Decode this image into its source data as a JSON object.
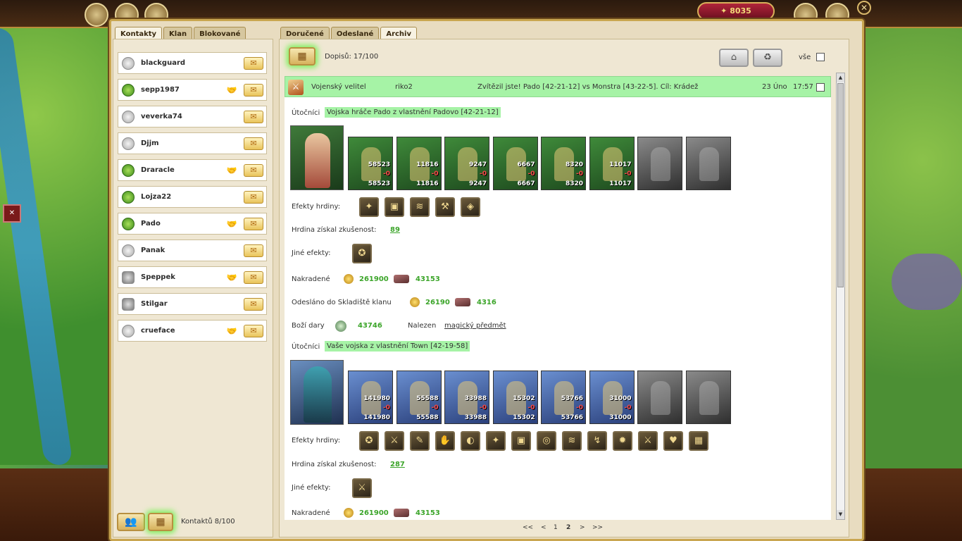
{
  "top": {
    "gold": "8035",
    "close_symbol": "✕"
  },
  "contacts_tabs": [
    "Kontakty",
    "Klan",
    "Blokované"
  ],
  "contacts": [
    {
      "name": "blackguard",
      "icon": "grey",
      "hands": false
    },
    {
      "name": "sepp1987",
      "icon": "green",
      "hands": true
    },
    {
      "name": "veverka74",
      "icon": "grey",
      "hands": false
    },
    {
      "name": "Djjm",
      "icon": "grey",
      "hands": false
    },
    {
      "name": "Draracle",
      "icon": "green",
      "hands": true
    },
    {
      "name": "Lojza22",
      "icon": "green",
      "hands": false
    },
    {
      "name": "Pado",
      "icon": "green",
      "hands": true
    },
    {
      "name": "Panak",
      "icon": "grey",
      "hands": false
    },
    {
      "name": "Speppek",
      "icon": "lock",
      "hands": true
    },
    {
      "name": "Stilgar",
      "icon": "lock",
      "hands": false
    },
    {
      "name": "crueface",
      "icon": "grey",
      "hands": true
    }
  ],
  "contacts_footer": {
    "count_label": "Kontaktů 8/100"
  },
  "mail_tabs": [
    "Doručené",
    "Odeslané",
    "Archiv"
  ],
  "mail_toolbar": {
    "count_label": "Dopisů: 17/100",
    "all_label": "vše"
  },
  "message": {
    "type": "Vojenský velitel",
    "from": "riko2",
    "subject": "Zvítězil jste! Pado [42-21-12] vs Monstra [43-22-5]. Cíl: Krádež",
    "date": "23 Úno",
    "time": "17:57"
  },
  "battle1": {
    "label": "Útočníci",
    "army": "Vojska hráče Pado z vlastnění Padovo [42-21-12]",
    "units": [
      {
        "a": "58523",
        "b": "-0",
        "c": "58523",
        "style": "green"
      },
      {
        "a": "11816",
        "b": "-0",
        "c": "11816",
        "style": "green"
      },
      {
        "a": "9247",
        "b": "-0",
        "c": "9247",
        "style": "green"
      },
      {
        "a": "6667",
        "b": "-0",
        "c": "6667",
        "style": "green"
      },
      {
        "a": "8320",
        "b": "-0",
        "c": "8320",
        "style": "green"
      },
      {
        "a": "11017",
        "b": "-0",
        "c": "11017",
        "style": "green"
      },
      {
        "a": "",
        "b": "",
        "c": "",
        "style": "grey"
      },
      {
        "a": "",
        "b": "",
        "c": "",
        "style": "grey"
      }
    ],
    "effects_label": "Efekty hrdiny:",
    "effects": [
      "✦",
      "▣",
      "≋",
      "⚒",
      "◈"
    ],
    "xp_label": "Hrdina získal zkušenost:",
    "xp": "89",
    "other_label": "Jiné efekty:",
    "other": [
      "✪"
    ],
    "stolen_label": "Nakradené",
    "stolen_gold": "261900",
    "stolen_ore": "43153",
    "sent_label": "Odesláno do Skladiště klanu",
    "sent_gold": "26190",
    "sent_ore": "4316",
    "gift_label": "Boží dary",
    "gift": "43746",
    "found_label": "Nalezen",
    "found_item": "magický předmět"
  },
  "battle2": {
    "label": "Útočníci",
    "army": "Vaše vojska z vlastnění Town [42-19-58]",
    "units": [
      {
        "a": "141980",
        "b": "-0",
        "c": "141980",
        "style": "blue"
      },
      {
        "a": "55588",
        "b": "-0",
        "c": "55588",
        "style": "blue"
      },
      {
        "a": "33988",
        "b": "-0",
        "c": "33988",
        "style": "blue"
      },
      {
        "a": "15302",
        "b": "-0",
        "c": "15302",
        "style": "blue"
      },
      {
        "a": "53766",
        "b": "-0",
        "c": "53766",
        "style": "blue"
      },
      {
        "a": "31000",
        "b": "-0",
        "c": "31000",
        "style": "blue"
      },
      {
        "a": "",
        "b": "",
        "c": "",
        "style": "grey"
      },
      {
        "a": "",
        "b": "",
        "c": "",
        "style": "grey"
      }
    ],
    "effects_label": "Efekty hrdiny:",
    "effects": [
      "✪",
      "⚔",
      "✎",
      "✋",
      "◐",
      "✦",
      "▣",
      "◎",
      "≋",
      "↯",
      "✹",
      "⚔",
      "♥",
      "▦"
    ],
    "xp_label": "Hrdina získal zkušenost:",
    "xp": "287",
    "other_label": "Jiné efekty:",
    "other": [
      "⚔"
    ],
    "stolen_label": "Nakradené",
    "stolen_gold": "261900",
    "stolen_ore": "43153"
  },
  "pager": {
    "first": "<<",
    "prev": "<",
    "p1": "1",
    "p2": "2",
    "next": ">",
    "last": ">>"
  }
}
